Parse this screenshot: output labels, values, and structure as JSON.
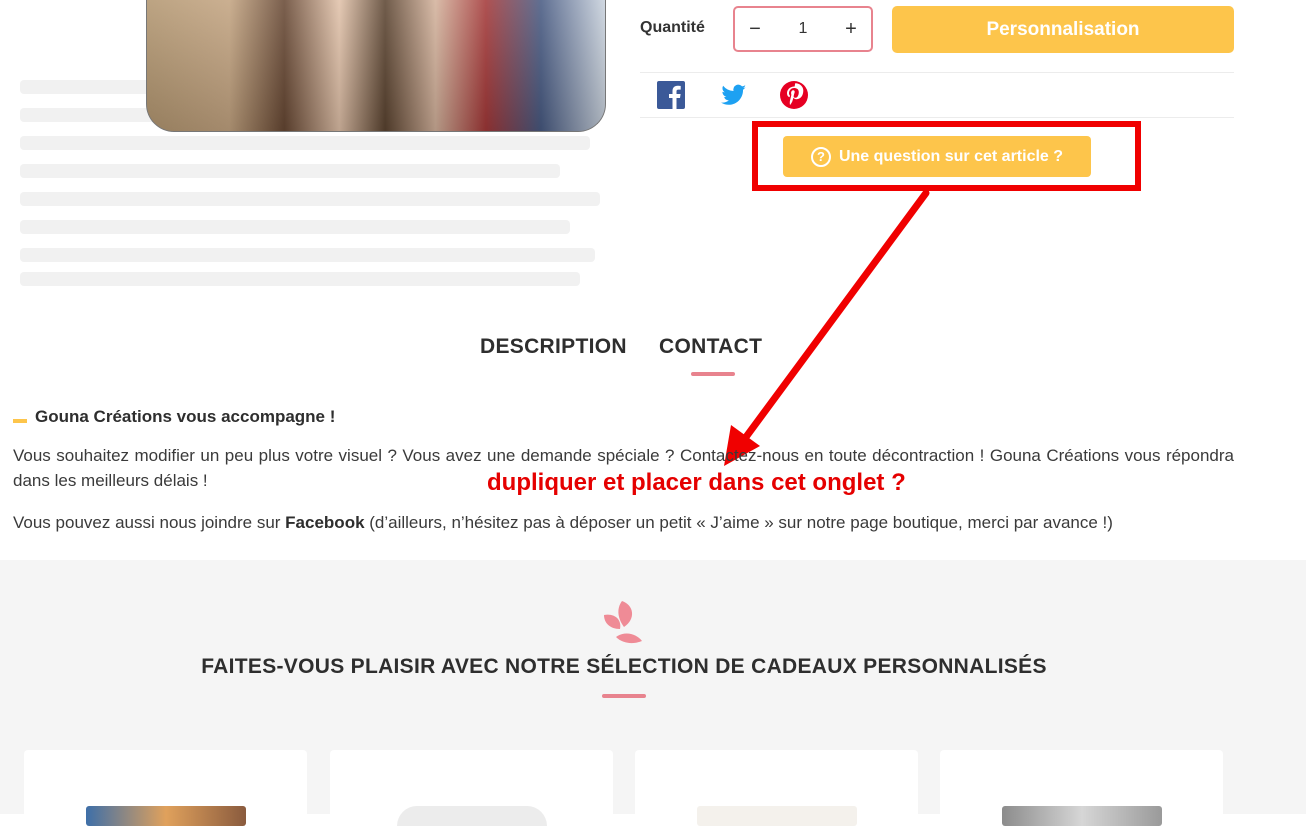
{
  "product": {
    "quantity_label": "Quantité",
    "quantity_value": "1",
    "decrement_label": "−",
    "increment_label": "+",
    "personalize_label": "Personnalisation",
    "question_label": "Une question sur cet article ?",
    "question_icon": "?"
  },
  "social": [
    {
      "name": "facebook-icon",
      "color": "#3b5998"
    },
    {
      "name": "twitter-icon",
      "color": "#1da1f2"
    },
    {
      "name": "pinterest-icon",
      "color": "#e60023"
    }
  ],
  "annotation": {
    "note": "dupliquer et placer dans cet onglet ?",
    "color": "#f00000"
  },
  "tabs": [
    {
      "label": "DESCRIPTION",
      "active": false
    },
    {
      "label": "CONTACT",
      "active": true
    }
  ],
  "contact": {
    "title": "Gouna Créations vous accompagne !",
    "paragraph1": "Vous souhaitez modifier un peu plus votre visuel ? Vous avez une demande spéciale ? Contactez-nous en toute décontraction ! Gouna Créations vous répondra dans les meilleurs délais !",
    "paragraph2_before": "Vous pouvez aussi nous joindre sur ",
    "paragraph2_link": "Facebook",
    "paragraph2_after": " (d’ailleurs, n’hésitez pas à déposer un petit « J’aime » sur notre page boutique, merci par avance !)"
  },
  "selection": {
    "title": "FAITES-VOUS PLAISIR AVEC NOTRE SÉLECTION DE CADEAUX PERSONNALISÉS"
  },
  "colors": {
    "accent_yellow": "#fdc54b",
    "accent_pink": "#e8838e",
    "annotation_red": "#e50000"
  }
}
